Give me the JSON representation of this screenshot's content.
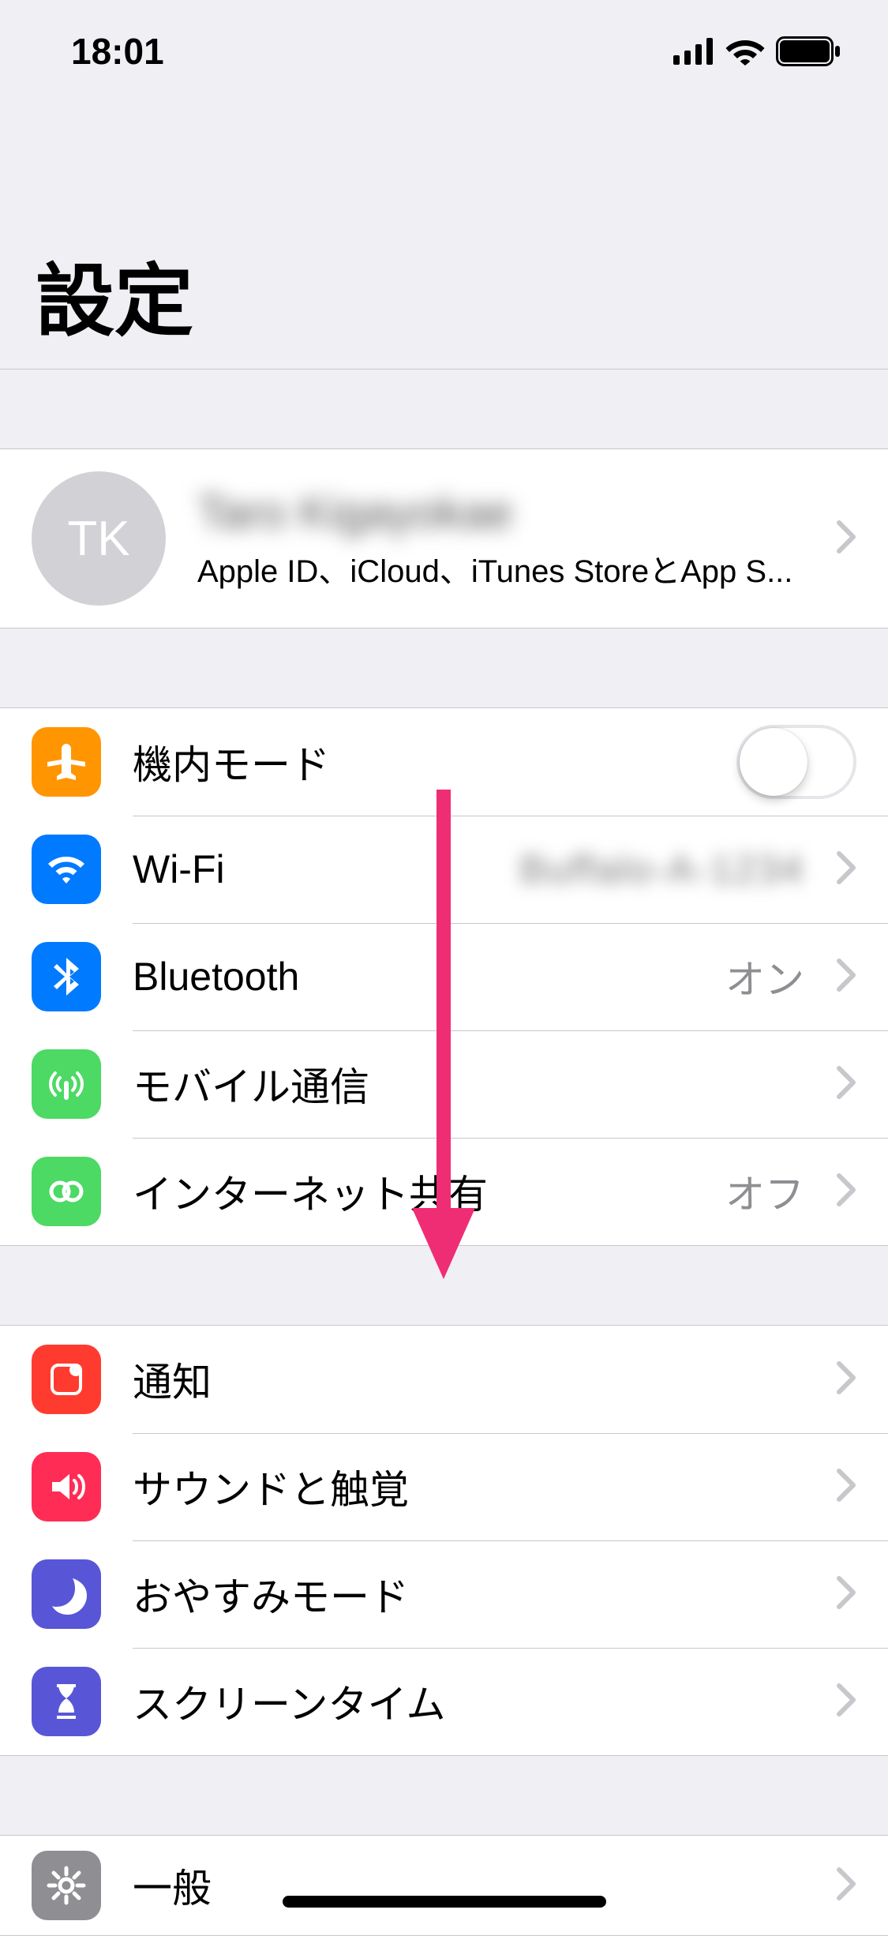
{
  "status": {
    "time": "18:01"
  },
  "title": "設定",
  "account": {
    "initials": "TK",
    "name": "Taro Kigayokae",
    "subtitle": "Apple ID、iCloud、iTunes StoreとApp S..."
  },
  "group1": {
    "airplane": {
      "label": "機内モード"
    },
    "wifi": {
      "label": "Wi-Fi",
      "value": "Buffalo-A-1234"
    },
    "bluetooth": {
      "label": "Bluetooth",
      "value": "オン"
    },
    "cellular": {
      "label": "モバイル通信"
    },
    "hotspot": {
      "label": "インターネット共有",
      "value": "オフ"
    }
  },
  "group2": {
    "notifications": {
      "label": "通知"
    },
    "sounds": {
      "label": "サウンドと触覚"
    },
    "dnd": {
      "label": "おやすみモード"
    },
    "screentime": {
      "label": "スクリーンタイム"
    }
  },
  "group3": {
    "general": {
      "label": "一般"
    }
  },
  "annotation": {
    "arrow_color": "#ef2d74"
  }
}
